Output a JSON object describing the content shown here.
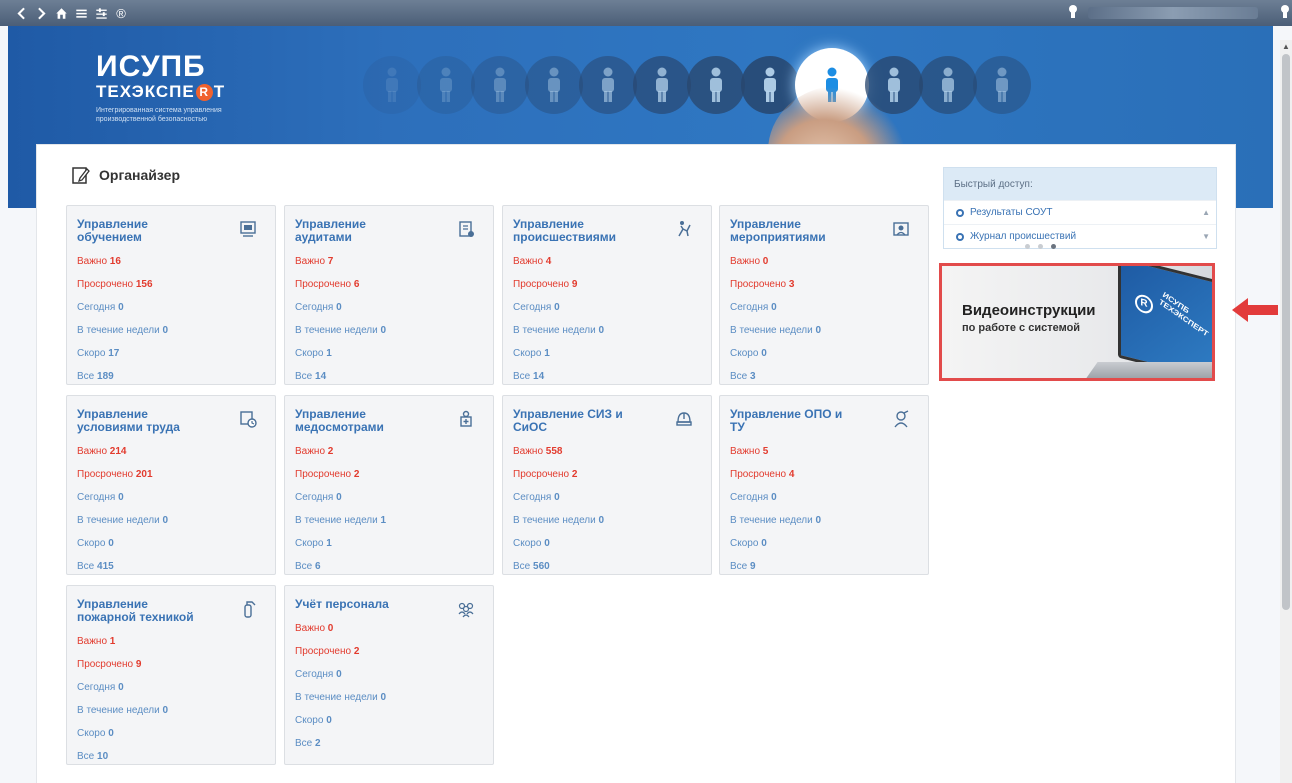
{
  "toolbar": {
    "back_icon": "chevron-left-icon",
    "forward_icon": "chevron-right-icon",
    "home_icon": "home-icon",
    "menu_icon": "hamburger-icon",
    "filter_icon": "sliders-icon",
    "r_icon": "registered-icon",
    "r_symbol": "®"
  },
  "logo": {
    "title": "ИСУПБ",
    "sub_a": "ТЕХЭКСПЕ",
    "sub_r": "R",
    "sub_b": "Т",
    "desc": "Интегрированная система управления производственной безопасностью"
  },
  "organizer": {
    "title": "Органайзер"
  },
  "tiles": [
    {
      "title": "Управление обучением",
      "icon": "training-icon",
      "important_label": "Важно",
      "important": "16",
      "overdue_label": "Просрочено",
      "overdue": "156",
      "today_label": "Сегодня",
      "today": "0",
      "week_label": "В течение недели",
      "week": "0",
      "soon_label": "Скоро",
      "soon": "17",
      "all_label": "Все",
      "all": "189"
    },
    {
      "title": "Управление аудитами",
      "icon": "audit-icon",
      "important_label": "Важно",
      "important": "7",
      "overdue_label": "Просрочено",
      "overdue": "6",
      "today_label": "Сегодня",
      "today": "0",
      "week_label": "В течение недели",
      "week": "0",
      "soon_label": "Скоро",
      "soon": "1",
      "all_label": "Все",
      "all": "14"
    },
    {
      "title": "Управление происшествиями",
      "icon": "incident-icon",
      "important_label": "Важно",
      "important": "4",
      "overdue_label": "Просрочено",
      "overdue": "9",
      "today_label": "Сегодня",
      "today": "0",
      "week_label": "В течение недели",
      "week": "0",
      "soon_label": "Скоро",
      "soon": "1",
      "all_label": "Все",
      "all": "14"
    },
    {
      "title": "Управление мероприятиями",
      "icon": "events-icon",
      "important_label": "Важно",
      "important": "0",
      "overdue_label": "Просрочено",
      "overdue": "3",
      "today_label": "Сегодня",
      "today": "0",
      "week_label": "В течение недели",
      "week": "0",
      "soon_label": "Скоро",
      "soon": "0",
      "all_label": "Все",
      "all": "3"
    },
    {
      "title": "Управление условиями труда",
      "icon": "work-conditions-icon",
      "important_label": "Важно",
      "important": "214",
      "overdue_label": "Просрочено",
      "overdue": "201",
      "today_label": "Сегодня",
      "today": "0",
      "week_label": "В течение недели",
      "week": "0",
      "soon_label": "Скоро",
      "soon": "0",
      "all_label": "Все",
      "all": "415"
    },
    {
      "title": "Управление медосмотрами",
      "icon": "medical-icon",
      "important_label": "Важно",
      "important": "2",
      "overdue_label": "Просрочено",
      "overdue": "2",
      "today_label": "Сегодня",
      "today": "0",
      "week_label": "В течение недели",
      "week": "1",
      "soon_label": "Скоро",
      "soon": "1",
      "all_label": "Все",
      "all": "6"
    },
    {
      "title": "Управление СИЗ и СиОС",
      "icon": "helmet-icon",
      "important_label": "Важно",
      "important": "558",
      "overdue_label": "Просрочено",
      "overdue": "2",
      "today_label": "Сегодня",
      "today": "0",
      "week_label": "В течение недели",
      "week": "0",
      "soon_label": "Скоро",
      "soon": "0",
      "all_label": "Все",
      "all": "560"
    },
    {
      "title": "Управление ОПО и ТУ",
      "icon": "worker-icon",
      "important_label": "Важно",
      "important": "5",
      "overdue_label": "Просрочено",
      "overdue": "4",
      "today_label": "Сегодня",
      "today": "0",
      "week_label": "В течение недели",
      "week": "0",
      "soon_label": "Скоро",
      "soon": "0",
      "all_label": "Все",
      "all": "9"
    },
    {
      "title": "Управление пожарной техникой",
      "icon": "fire-extinguisher-icon",
      "important_label": "Важно",
      "important": "1",
      "overdue_label": "Просрочено",
      "overdue": "9",
      "today_label": "Сегодня",
      "today": "0",
      "week_label": "В течение недели",
      "week": "0",
      "soon_label": "Скоро",
      "soon": "0",
      "all_label": "Все",
      "all": "10"
    },
    {
      "title": "Учёт персонала",
      "icon": "people-icon",
      "important_label": "Важно",
      "important": "0",
      "overdue_label": "Просрочено",
      "overdue": "2",
      "today_label": "Сегодня",
      "today": "0",
      "week_label": "В течение недели",
      "week": "0",
      "soon_label": "Скоро",
      "soon": "0",
      "all_label": "Все",
      "all": "2"
    }
  ],
  "quick_access": {
    "title": "Быстрый доступ:",
    "items": [
      "Результаты СОУТ",
      "Журнал происшествий"
    ]
  },
  "video_banner": {
    "title": "Видеоинструкции",
    "subtitle": "по работе с системой",
    "laptop_text_1": "ИСУПБ",
    "laptop_text_2": "ТЕХЭКСПЕРТ"
  },
  "colors": {
    "accent": "#3a73b4",
    "alert": "#e23b2e",
    "banner": "#2d6fbb",
    "highlight_border": "#e24b4b"
  }
}
